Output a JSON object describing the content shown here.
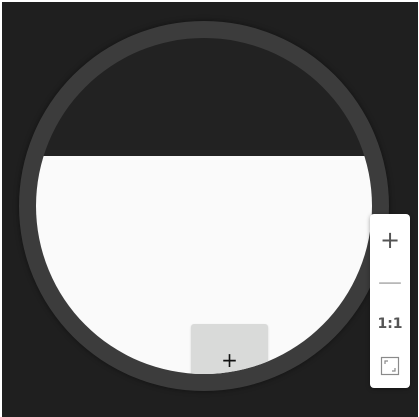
{
  "add_node": {
    "label": "+"
  },
  "zoom_toolbar": {
    "zoom_in_label": "+",
    "zoom_out_label": "—",
    "actual_size_label": "1:1",
    "zoom_out_disabled": true,
    "fit_icon": "fit-to-screen-icon"
  },
  "colors": {
    "background": "#1f1f1f",
    "ring": "#3c3c3c",
    "canvas_white": "#fafafa",
    "node_fill": "#d9dad9",
    "toolbar_bg": "#ffffff",
    "icon": "#555555",
    "icon_disabled": "#b8b8b8"
  }
}
